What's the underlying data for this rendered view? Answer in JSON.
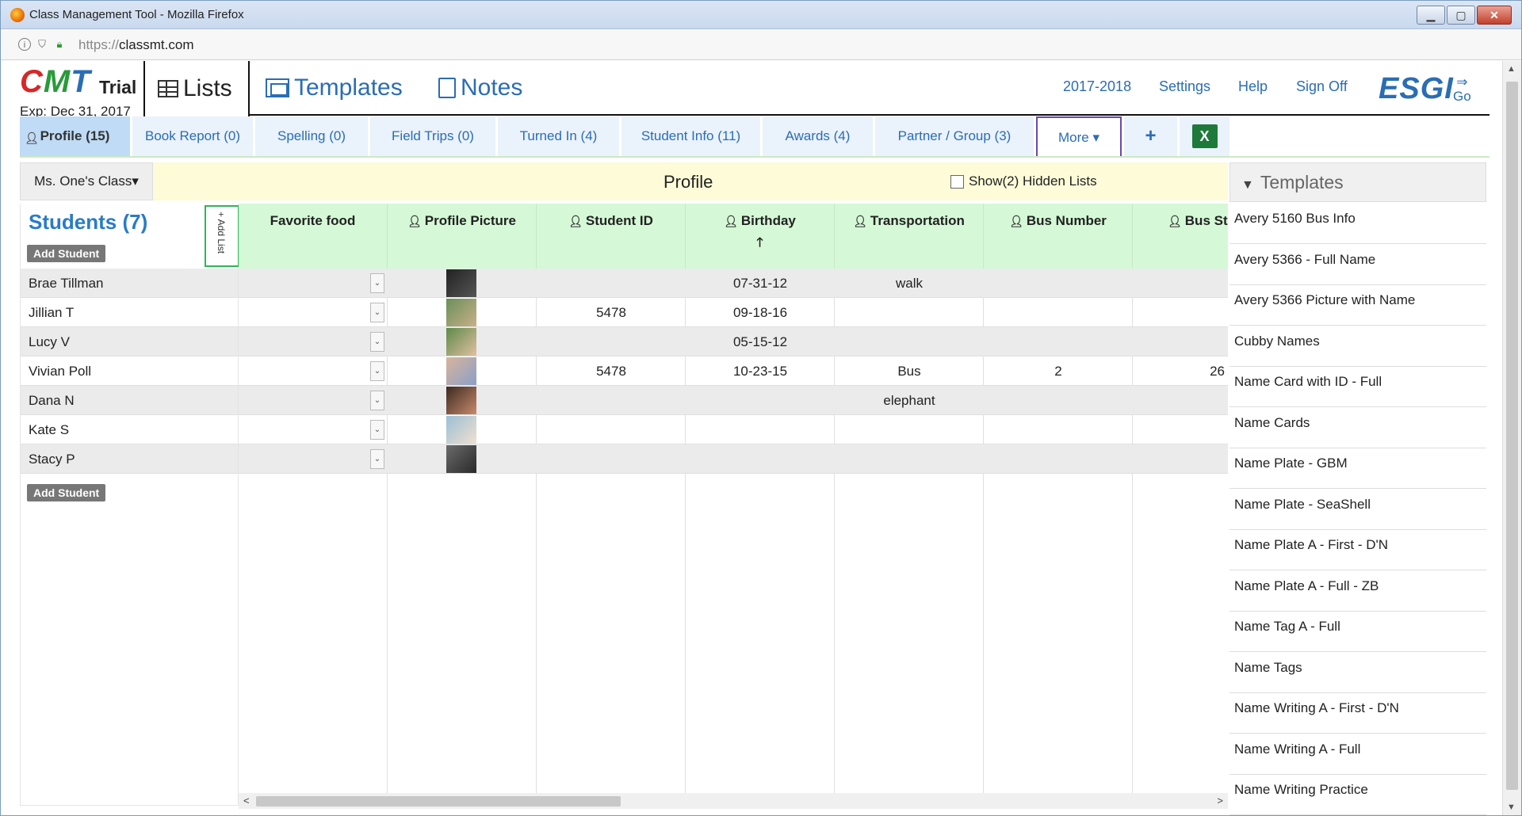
{
  "window": {
    "title": "Class Management Tool - Mozilla Firefox",
    "url_scheme": "https://",
    "url_host": "classmt.com"
  },
  "header": {
    "logo": "CMT",
    "trial": "Trial",
    "expires": "Exp: Dec 31, 2017",
    "tabs": [
      "Lists",
      "Templates",
      "Notes"
    ],
    "links": [
      "2017-2018",
      "Settings",
      "Help",
      "Sign Off"
    ],
    "esgi": "ESGI",
    "go": "Go"
  },
  "list_tabs": [
    "Profile (15)",
    "Book Report (0)",
    "Spelling (0)",
    "Field Trips (0)",
    "Turned In (4)",
    "Student Info (11)",
    "Awards (4)",
    "Partner / Group (3)",
    "More ▾",
    "+"
  ],
  "class_bar": {
    "class_select": "Ms. One's Class▾",
    "title": "Profile",
    "hidden_lists": "Show(2) Hidden Lists"
  },
  "students": {
    "title": "Students (7)",
    "add_student": "Add Student",
    "add_list": "+ Add List",
    "names": [
      "Brae Tillman",
      "Jillian T",
      "Lucy V",
      "Vivian Poll",
      "Dana N",
      "Kate S",
      "Stacy P"
    ]
  },
  "columns": [
    "Favorite food",
    "Profile Picture",
    "Student ID",
    "Birthday",
    "Transportation",
    "Bus Number",
    "Bus St"
  ],
  "rows": [
    {
      "student_id": "",
      "birthday": "07-31-12",
      "transportation": "walk",
      "bus_number": "",
      "bus_stop": ""
    },
    {
      "student_id": "5478",
      "birthday": "09-18-16",
      "transportation": "",
      "bus_number": "",
      "bus_stop": ""
    },
    {
      "student_id": "",
      "birthday": "05-15-12",
      "transportation": "",
      "bus_number": "",
      "bus_stop": ""
    },
    {
      "student_id": "5478",
      "birthday": "10-23-15",
      "transportation": "Bus",
      "bus_number": "2",
      "bus_stop": "26"
    },
    {
      "student_id": "",
      "birthday": "",
      "transportation": "elephant",
      "bus_number": "",
      "bus_stop": ""
    },
    {
      "student_id": "",
      "birthday": "",
      "transportation": "",
      "bus_number": "",
      "bus_stop": ""
    },
    {
      "student_id": "",
      "birthday": "",
      "transportation": "",
      "bus_number": "",
      "bus_stop": ""
    }
  ],
  "templates": {
    "title": "Templates",
    "items": [
      "Avery 5160 Bus Info",
      "Avery 5366 - Full Name",
      "Avery 5366 Picture with Name",
      "Cubby Names",
      "Name Card with ID - Full",
      "Name Cards",
      "Name Plate - GBM",
      "Name Plate - SeaShell",
      "Name Plate A - First - D'N",
      "Name Plate A - Full - ZB",
      "Name Tag A - Full",
      "Name Tags",
      "Name Writing A - First - D'N",
      "Name Writing A - Full",
      "Name Writing Practice"
    ]
  },
  "colors": {
    "accent": "#2a6db5",
    "header_green": "#d5f9d6",
    "class_bar": "#fdfbd8",
    "active_tab": "#bfdbf5"
  }
}
